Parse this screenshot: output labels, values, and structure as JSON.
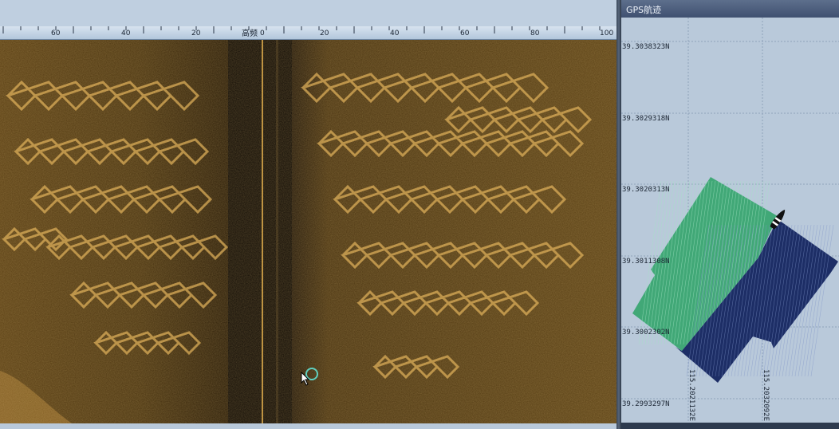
{
  "window": {
    "center_label": "高频",
    "ruler_ticks": [
      "60",
      "40",
      "20",
      "0",
      "20",
      "40",
      "60",
      "80",
      "100"
    ]
  },
  "gps_panel": {
    "title": "GPS航迹",
    "lat_labels": [
      "39.3038323N",
      "39.3029318N",
      "39.3020313N",
      "39.3011308N",
      "39.3002302N",
      "39.2993297N"
    ],
    "lon_labels": [
      "115.2021132E",
      "115.2032092E"
    ],
    "colors": {
      "track_green": "#3aa772",
      "track_navy": "#1d2e66",
      "grid": "#8fa3bb",
      "background": "#b9c9da"
    },
    "boat_icon": "boat-icon"
  },
  "sonar": {
    "palette": {
      "dark": "#1e1406",
      "mid": "#5e4317",
      "light": "#b58a3c",
      "highlight": "#e8b85a"
    }
  },
  "cursor": {
    "icon": "pointer-arrow-icon"
  }
}
